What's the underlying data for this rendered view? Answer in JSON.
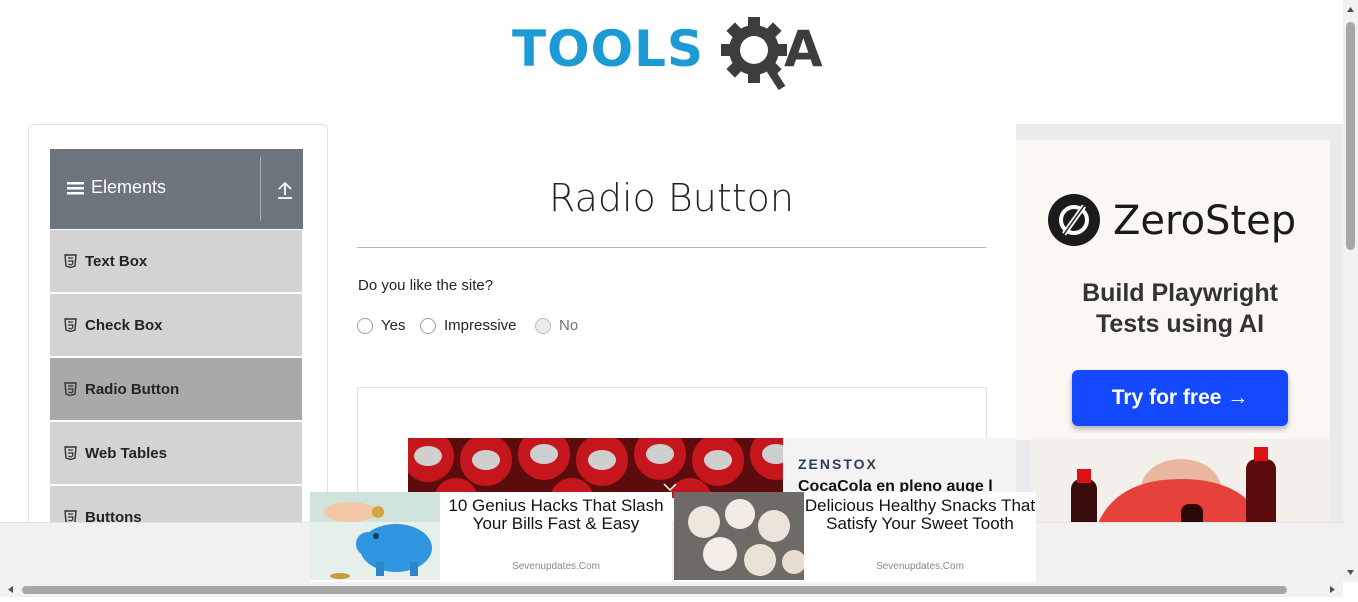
{
  "logo": {
    "text_blue": "TOOLS",
    "text_dark": "QA"
  },
  "sidebar": {
    "group_title": "Elements",
    "items": [
      {
        "label": "Text Box",
        "active": false
      },
      {
        "label": "Check Box",
        "active": false
      },
      {
        "label": "Radio Button",
        "active": true
      },
      {
        "label": "Web Tables",
        "active": false
      },
      {
        "label": "Buttons",
        "active": false
      }
    ]
  },
  "main": {
    "title": "Radio Button",
    "question": "Do you like the site?",
    "options": [
      {
        "label": "Yes",
        "disabled": false
      },
      {
        "label": "Impressive",
        "disabled": false
      },
      {
        "label": "No",
        "disabled": true
      }
    ]
  },
  "inline_ad": {
    "brand": "ZENSTOX",
    "headline": "CocaCola en pleno auge l"
  },
  "right_ad": {
    "brand": "ZeroStep",
    "tagline_line1": "Build Playwright",
    "tagline_line2": "Tests using AI",
    "cta": "Try for free →"
  },
  "bottom_ads": [
    {
      "headline": "10 Genius Hacks That Slash Your Bills Fast & Easy",
      "source": "Sevenupdates.Com"
    },
    {
      "headline": "Delicious Healthy Snacks That Satisfy Your Sweet Tooth",
      "source": "Sevenupdates.Com"
    }
  ],
  "colors": {
    "brand_blue": "#1c9ad6",
    "brand_dark": "#3d3d3d",
    "sidebar_header": "#6c757d",
    "menu_item": "#d3d3d3",
    "menu_item_active": "#a9a9a9",
    "cta_blue": "#1549ff"
  }
}
